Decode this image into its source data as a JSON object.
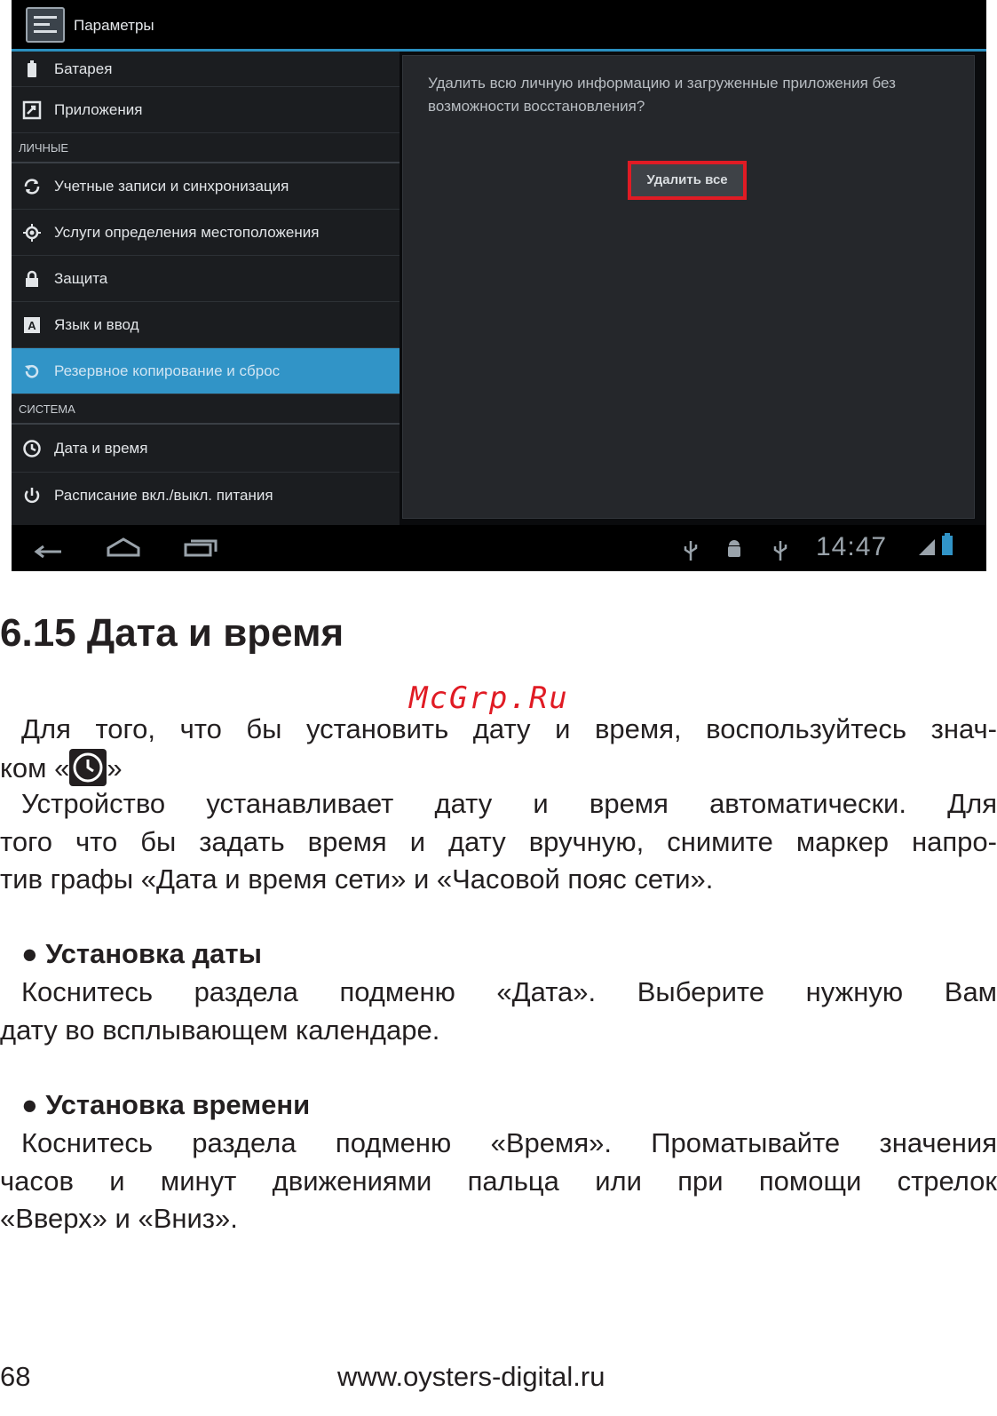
{
  "screenshot": {
    "app_title": "Параметры",
    "menu": [
      {
        "label": "Батарея",
        "icon": "battery-icon"
      },
      {
        "label": "Приложения",
        "icon": "apps-icon"
      },
      {
        "section": "ЛИЧНЫЕ"
      },
      {
        "label": "Учетные записи и синхронизация",
        "icon": "sync-icon"
      },
      {
        "label": "Услуги определения местоположения",
        "icon": "location-icon"
      },
      {
        "label": "Защита",
        "icon": "lock-icon"
      },
      {
        "label": "Язык и ввод",
        "icon": "keyboard-icon"
      },
      {
        "label": "Резервное копирование и сброс",
        "icon": "backup-icon",
        "selected": true
      },
      {
        "section": "СИСТЕМА"
      },
      {
        "label": "Дата и время",
        "icon": "clock-icon"
      },
      {
        "label": "Расписание вкл./выкл. питания",
        "icon": "power-icon"
      }
    ],
    "warning_text": "Удалить всю личную информацию и загруженные приложения без возможности восстановления?",
    "delete_all_label": "Удалить все",
    "clock": "14:47",
    "highlight_color": "#e01b24",
    "accent_color": "#3194c7"
  },
  "doc": {
    "heading": "6.15 Дата и время",
    "watermark": "McGrp.Ru",
    "p1_line1": "Для того, что бы установить дату и время, воспользуйтесь знач-",
    "p1_line2_a": "ком «",
    "p1_line2_b": "»",
    "p2_line1": "Устройство устанавливает дату и время автоматически. Для",
    "p2_line2": "того что бы задать время и дату вручную, снимите маркер напро-",
    "p2_line3": "тив графы «Дата и время сети» и «Часовой пояс сети».",
    "sub1": "● Установка даты",
    "p3_line1": "Коснитесь раздела подменю «Дата». Выберите нужную Вам",
    "p3_line2": "дату во всплывающем календаре.",
    "sub2": "● Установка времени",
    "p4_line1": "Коснитесь раздела подменю «Время». Проматывайте значения",
    "p4_line2": "часов и минут движениями пальца или при помощи стрелок",
    "p4_line3": "«Вверх» и «Вниз».",
    "page_number": "68",
    "site": "www.oysters-digital.ru"
  }
}
